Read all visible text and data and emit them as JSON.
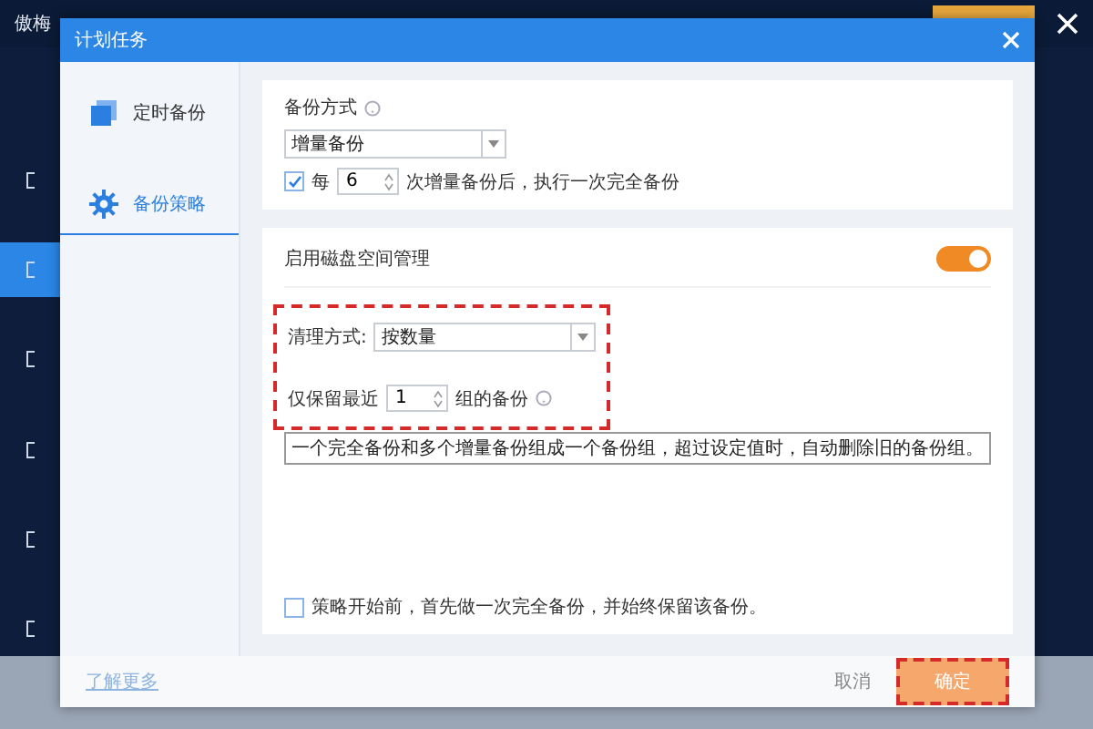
{
  "app": {
    "title": "傲梅",
    "nav": [
      {
        "selected": false
      },
      {
        "selected": true
      },
      {
        "selected": false
      },
      {
        "selected": false
      },
      {
        "selected": false
      },
      {
        "selected": false
      }
    ]
  },
  "dialog": {
    "title": "计划任务",
    "sidebar": {
      "items": [
        {
          "label": "定时备份",
          "kind": "schedule",
          "selected": false
        },
        {
          "label": "备份策略",
          "kind": "gear",
          "selected": true
        }
      ]
    },
    "backup_mode": {
      "label": "备份方式",
      "value": "增量备份",
      "full_every": {
        "checked": true,
        "prefix": "每",
        "value": "6",
        "suffix": "次增量备份后，执行一次完全备份"
      }
    },
    "disk_space": {
      "label": "启用磁盘空间管理",
      "on": true,
      "cleanup": {
        "highlighted": true,
        "label": "清理方式:",
        "value": "按数量",
        "keep_prefix": "仅保留最近",
        "keep_value": "1",
        "keep_suffix": "组的备份"
      },
      "tooltip": "一个完全备份和多个增量备份组成一个备份组，超过设定值时，自动删除旧的备份组。"
    },
    "full_first": {
      "checked": false,
      "label": "策略开始前，首先做一次完全备份，并始终保留该备份。"
    },
    "footer": {
      "link": "了解更多",
      "cancel": "取消",
      "confirm": "确定",
      "confirm_highlighted": true
    }
  }
}
